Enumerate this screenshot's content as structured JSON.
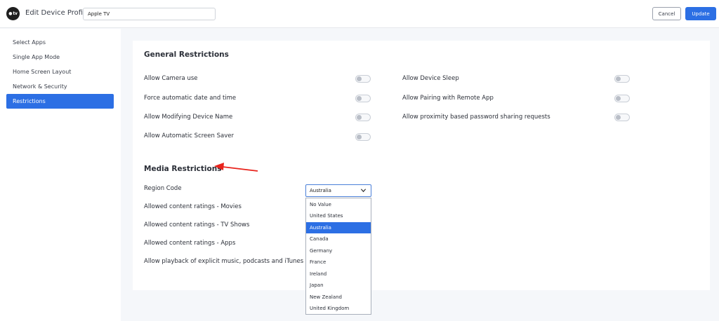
{
  "header": {
    "logo_text": "tv",
    "title": "Edit Device Profile",
    "profile_name": "Apple TV",
    "cancel_label": "Cancel",
    "update_label": "Update"
  },
  "sidebar": {
    "items": [
      {
        "label": "Select Apps",
        "active": false
      },
      {
        "label": "Single App Mode",
        "active": false
      },
      {
        "label": "Home Screen Layout",
        "active": false
      },
      {
        "label": "Network & Security",
        "active": false
      },
      {
        "label": "Restrictions",
        "active": true
      }
    ]
  },
  "general": {
    "title": "General Restrictions",
    "left": [
      {
        "label": "Allow Camera use",
        "on": false
      },
      {
        "label": "Force automatic date and time",
        "on": false
      },
      {
        "label": "Allow Modifying Device Name",
        "on": false
      },
      {
        "label": "Allow Automatic Screen Saver",
        "on": false
      }
    ],
    "right": [
      {
        "label": "Allow Device Sleep",
        "on": false
      },
      {
        "label": "Allow Pairing with Remote App",
        "on": false
      },
      {
        "label": "Allow proximity based password sharing requests",
        "on": false
      }
    ]
  },
  "media": {
    "title": "Media Restrictions",
    "rows": [
      {
        "label": "Region Code"
      },
      {
        "label": "Allowed content ratings - Movies"
      },
      {
        "label": "Allowed content ratings - TV Shows"
      },
      {
        "label": "Allowed content ratings - Apps"
      },
      {
        "label": "Allow playback of explicit music, podcasts and iTunes"
      }
    ],
    "region_value": "Australia",
    "region_options": [
      "No Value",
      "United States",
      "Australia",
      "Canada",
      "Germany",
      "France",
      "Ireland",
      "Japan",
      "New Zealand",
      "United Kingdom"
    ],
    "selected_index": 2
  },
  "colors": {
    "accent": "#2c6fe4",
    "annotation_arrow": "#e8231c"
  }
}
